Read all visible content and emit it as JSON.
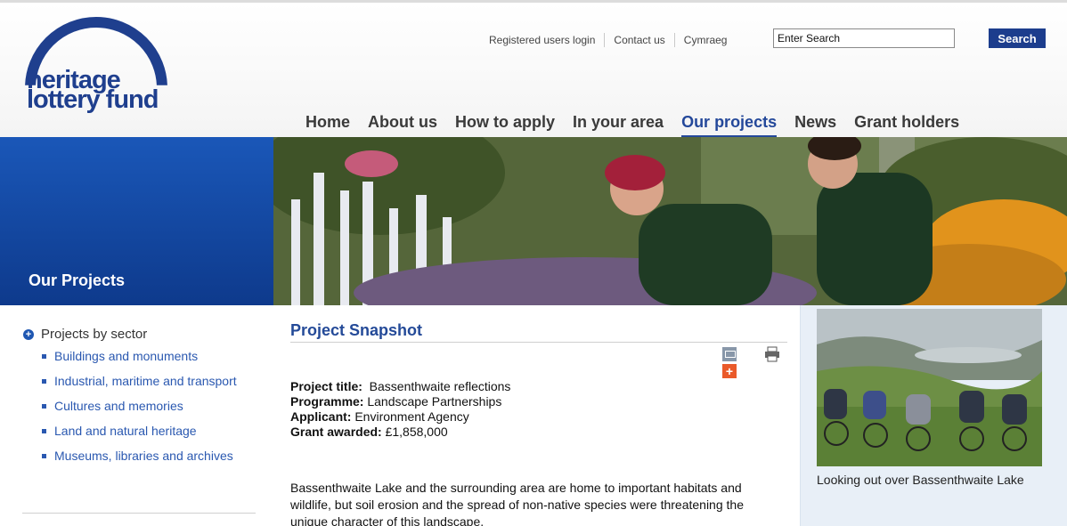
{
  "logo": {
    "line1": "heritage",
    "line2": "lottery fund"
  },
  "utility_links": [
    {
      "label": "Registered users login"
    },
    {
      "label": "Contact us"
    },
    {
      "label": "Cymraeg"
    }
  ],
  "search": {
    "value": "Enter Search",
    "button_label": "Search"
  },
  "nav": [
    {
      "label": "Home",
      "active": false
    },
    {
      "label": "About us",
      "active": false
    },
    {
      "label": "How to apply",
      "active": false
    },
    {
      "label": "In your area",
      "active": false
    },
    {
      "label": "Our projects",
      "active": true
    },
    {
      "label": "News",
      "active": false
    },
    {
      "label": "Grant holders",
      "active": false
    }
  ],
  "banner": {
    "title": "Our Projects"
  },
  "sidebar": {
    "heading": "Projects by sector",
    "items": [
      {
        "label": "Buildings and monuments"
      },
      {
        "label": "Industrial, maritime and transport"
      },
      {
        "label": "Cultures and memories"
      },
      {
        "label": "Land and natural heritage"
      },
      {
        "label": "Museums, libraries and archives"
      }
    ]
  },
  "snapshot": {
    "title": "Project Snapshot",
    "details": [
      {
        "label": "Project title:",
        "value": "  Bassenthwaite reflections"
      },
      {
        "label": "Programme:",
        "value": " Landscape Partnerships"
      },
      {
        "label": "Applicant:",
        "value": " Environment Agency"
      },
      {
        "label": "Grant awarded:",
        "value": " £1,858,000"
      }
    ],
    "description": "Bassenthwaite Lake and the surrounding area are home to important habitats and wildlife, but soil erosion and the spread of non-native species were threatening the unique character of this landscape."
  },
  "right_panel": {
    "caption": "Looking out over Bassenthwaite Lake"
  },
  "colors": {
    "brand_blue": "#1f3f8e",
    "link_blue": "#2a58b0",
    "panel_bg": "#e8eff7",
    "share_orange": "#ea5a2a"
  },
  "icons": {
    "email": "email-icon",
    "share": "plus-icon",
    "print": "printer-icon",
    "expand": "plus-circle-icon"
  }
}
